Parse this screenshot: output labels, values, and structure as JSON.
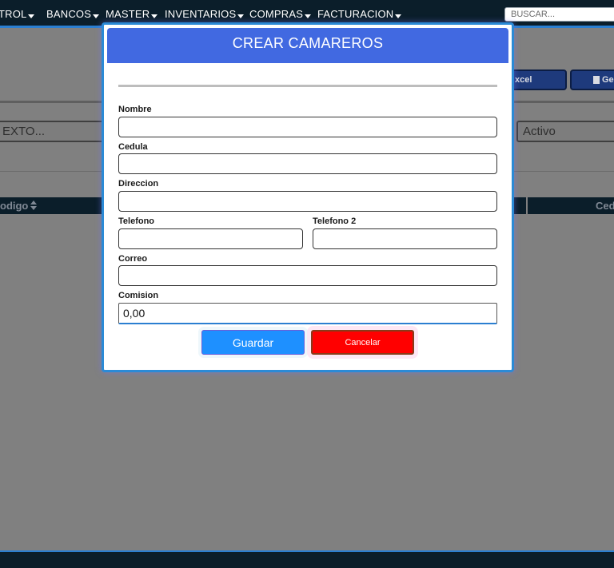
{
  "nav": {
    "items": [
      "TROL",
      "BANCOS",
      "MASTER",
      "INVENTARIOS",
      "COMPRAS",
      "FACTURACION"
    ],
    "search_placeholder": "BUSCAR..."
  },
  "background": {
    "excel_button": "xcel",
    "generate_button": "Ge",
    "search_text_placeholder": "EXTO...",
    "status_filter": "Activo",
    "column_codigo": "odigo",
    "column_cedula": "Ced"
  },
  "modal": {
    "title": "CREAR CAMAREROS",
    "fields": {
      "nombre": {
        "label": "Nombre",
        "value": ""
      },
      "cedula": {
        "label": "Cedula",
        "value": ""
      },
      "direccion": {
        "label": "Direccion",
        "value": ""
      },
      "telefono": {
        "label": "Telefono",
        "value": ""
      },
      "telefono2": {
        "label": "Telefono 2",
        "value": ""
      },
      "correo": {
        "label": "Correo",
        "value": ""
      },
      "comision": {
        "label": "Comision",
        "value": "0,00"
      }
    },
    "save_label": "Guardar",
    "cancel_label": "Cancelar"
  },
  "colors": {
    "nav_bg": "#0b1e2a",
    "accent": "#2b7fd1",
    "modal_header": "#4169e1",
    "save_button": "#1e90ff",
    "cancel_button": "#ff0000",
    "overlay": "#808080"
  },
  "icons": {
    "nav_dropdown": "caret-down-icon",
    "sort": "sort-icon",
    "document": "document-icon"
  }
}
